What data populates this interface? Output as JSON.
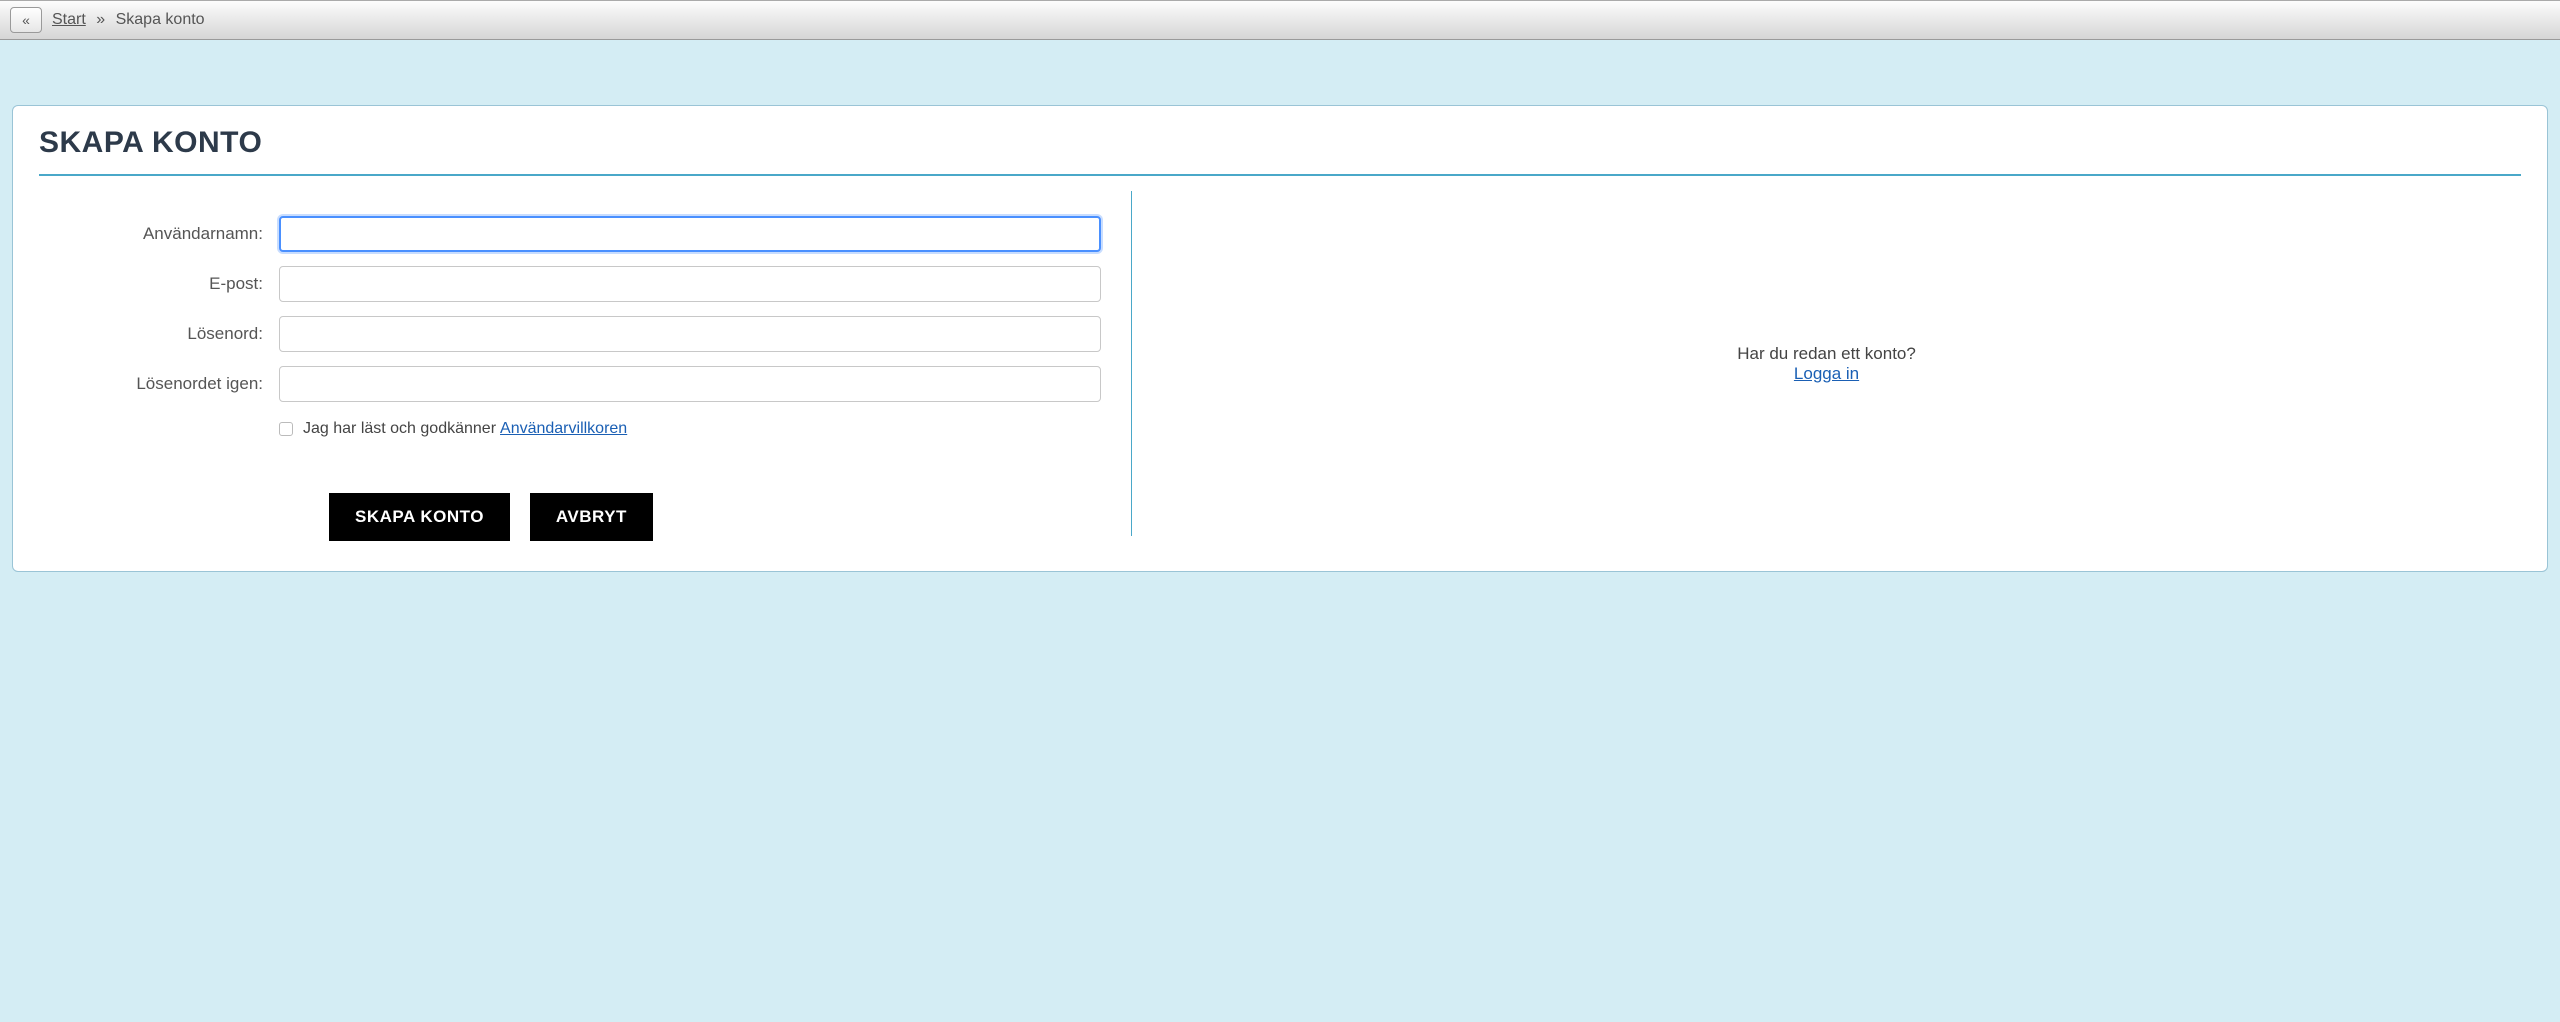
{
  "breadcrumb": {
    "start_label": "Start",
    "separator": "»",
    "current": "Skapa konto"
  },
  "page": {
    "title": "SKAPA KONTO"
  },
  "form": {
    "username_label": "Användarnamn:",
    "email_label": "E-post:",
    "password_label": "Lösenord:",
    "password_again_label": "Lösenordet igen:",
    "terms_prefix": "Jag har läst och godkänner",
    "terms_link": "Användarvillkoren",
    "submit_label": "SKAPA KONTO",
    "cancel_label": "AVBRYT"
  },
  "side": {
    "already_text": "Har du redan ett konto?",
    "login_link": "Logga in"
  }
}
